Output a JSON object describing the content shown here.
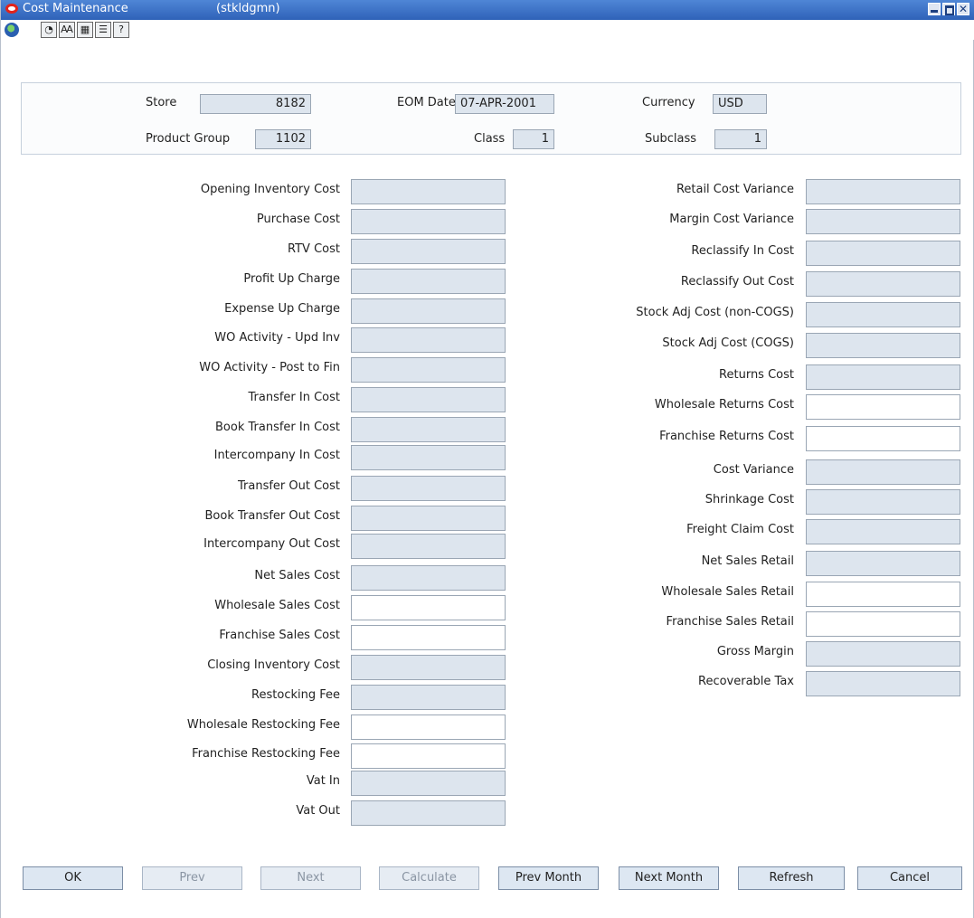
{
  "window": {
    "title": "Cost Maintenance",
    "subtitle": "(stkldgmn)"
  },
  "toolbar": {
    "icons": [
      "globe-icon",
      "help-icon",
      "find-icon",
      "calendar-icon",
      "list-icon",
      "question-icon"
    ]
  },
  "header": {
    "store_label": "Store",
    "store_value": "8182",
    "eom_label": "EOM Date",
    "eom_value": "07-APR-2001",
    "currency_label": "Currency",
    "currency_value": "USD",
    "product_group_label": "Product Group",
    "product_group_value": "1102",
    "class_label": "Class",
    "class_value": "1",
    "subclass_label": "Subclass",
    "subclass_value": "1"
  },
  "left_fields": [
    {
      "label": "Opening Inventory Cost",
      "value": "",
      "editable": false
    },
    {
      "label": "Purchase Cost",
      "value": "",
      "editable": false
    },
    {
      "label": "RTV Cost",
      "value": "",
      "editable": false
    },
    {
      "label": "Profit Up Charge",
      "value": "",
      "editable": false
    },
    {
      "label": "Expense Up Charge",
      "value": "",
      "editable": false
    },
    {
      "label": "WO Activity - Upd Inv",
      "value": "",
      "editable": false
    },
    {
      "label": "WO Activity - Post to Fin",
      "value": "",
      "editable": false
    },
    {
      "label": "Transfer In Cost",
      "value": "",
      "editable": false
    },
    {
      "label": "Book Transfer In Cost",
      "value": "",
      "editable": false
    },
    {
      "label": "Intercompany In Cost",
      "value": "",
      "editable": false
    },
    {
      "label": "Transfer Out Cost",
      "value": "",
      "editable": false
    },
    {
      "label": "Book Transfer Out Cost",
      "value": "",
      "editable": false
    },
    {
      "label": "Intercompany Out Cost",
      "value": "",
      "editable": false
    },
    {
      "label": "Net Sales Cost",
      "value": "",
      "editable": false
    },
    {
      "label": "Wholesale Sales Cost",
      "value": "",
      "editable": true
    },
    {
      "label": "Franchise Sales Cost",
      "value": "",
      "editable": true
    },
    {
      "label": "Closing Inventory Cost",
      "value": "",
      "editable": false
    },
    {
      "label": "Restocking Fee",
      "value": "",
      "editable": false
    },
    {
      "label": "Wholesale Restocking Fee",
      "value": "",
      "editable": true
    },
    {
      "label": "Franchise Restocking Fee",
      "value": "",
      "editable": true
    },
    {
      "label": "Vat In",
      "value": "",
      "editable": false
    },
    {
      "label": "Vat Out",
      "value": "",
      "editable": false
    }
  ],
  "right_fields": [
    {
      "label": "Retail Cost Variance",
      "value": "",
      "editable": false
    },
    {
      "label": "Margin Cost Variance",
      "value": "",
      "editable": false
    },
    {
      "label": "Reclassify In Cost",
      "value": "",
      "editable": false
    },
    {
      "label": "Reclassify Out Cost",
      "value": "",
      "editable": false
    },
    {
      "label": "Stock Adj Cost (non-COGS)",
      "value": "",
      "editable": false
    },
    {
      "label": "Stock Adj Cost (COGS)",
      "value": "",
      "editable": false
    },
    {
      "label": "Returns Cost",
      "value": "",
      "editable": false
    },
    {
      "label": "Wholesale Returns Cost",
      "value": "",
      "editable": true
    },
    {
      "label": "Franchise Returns Cost",
      "value": "",
      "editable": true
    },
    {
      "label": "Cost Variance",
      "value": "",
      "editable": false
    },
    {
      "label": "Shrinkage Cost",
      "value": "",
      "editable": false
    },
    {
      "label": "Freight Claim Cost",
      "value": "",
      "editable": false
    },
    {
      "label": "Net Sales Retail",
      "value": "",
      "editable": false
    },
    {
      "label": "Wholesale Sales Retail",
      "value": "",
      "editable": true
    },
    {
      "label": "Franchise Sales Retail",
      "value": "",
      "editable": true
    },
    {
      "label": "Gross Margin",
      "value": "",
      "editable": false
    },
    {
      "label": "Recoverable Tax",
      "value": "",
      "editable": false
    }
  ],
  "buttons": {
    "ok": "OK",
    "prev": "Prev",
    "next": "Next",
    "calculate": "Calculate",
    "prev_month": "Prev Month",
    "next_month": "Next Month",
    "refresh": "Refresh",
    "cancel": "Cancel"
  }
}
